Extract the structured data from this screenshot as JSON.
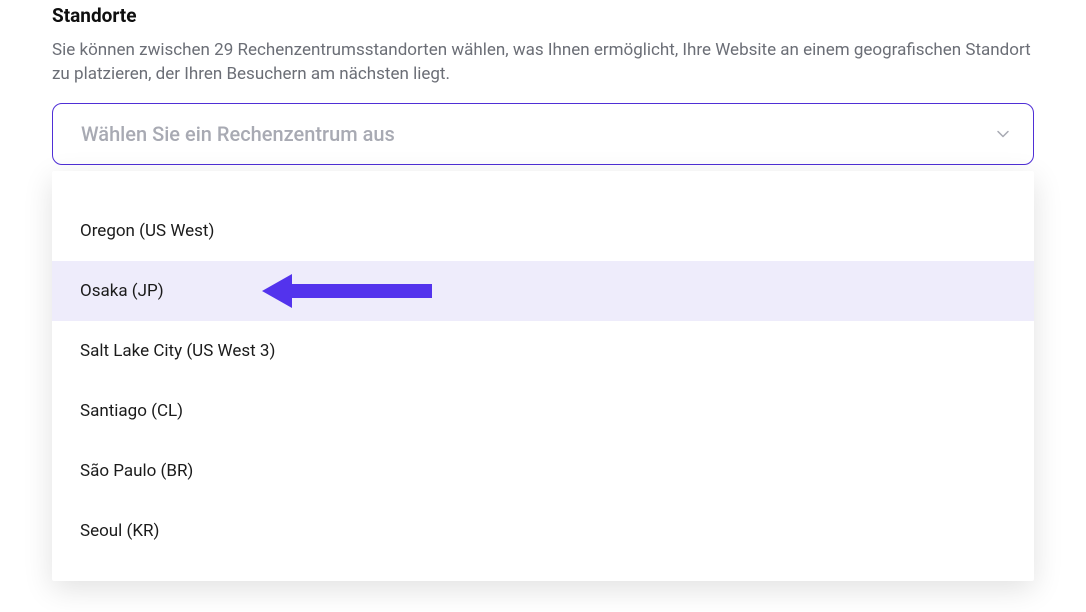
{
  "title": "Standorte",
  "description": "Sie können zwischen 29 Rechenzentrumsstandorten wählen, was Ihnen ermöglicht, Ihre Website an einem geografischen Standort zu platzieren, der Ihren Besuchern am nächsten liegt.",
  "select": {
    "placeholder": "Wählen Sie ein Rechenzentrum aus"
  },
  "colors": {
    "accent": "#4f2fd6",
    "highlight": "#eeecfb",
    "arrow": "#5333ed"
  },
  "options": [
    {
      "label": "",
      "partial": "top"
    },
    {
      "label": "Oregon (US West)"
    },
    {
      "label": "Osaka (JP)",
      "highlighted": true,
      "pointed": true
    },
    {
      "label": "Salt Lake City (US West 3)"
    },
    {
      "label": "Santiago (CL)"
    },
    {
      "label": "São Paulo (BR)"
    },
    {
      "label": "Seoul (KR)"
    },
    {
      "label": "",
      "partial": "bottom"
    }
  ]
}
